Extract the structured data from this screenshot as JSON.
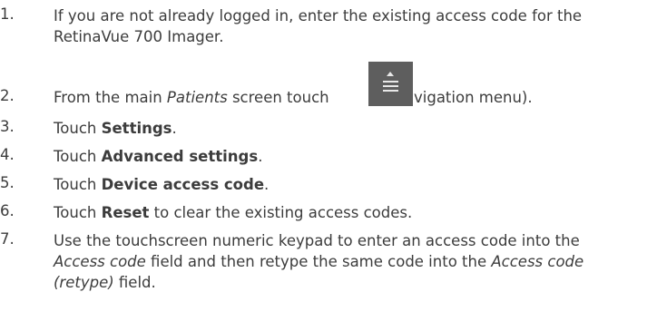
{
  "steps": [
    {
      "num": "1.",
      "line1": "If you are not already logged in, enter the existing access code for the",
      "line2": "RetinaVue 700 Imager."
    },
    {
      "num": "2.",
      "pre": "From the main ",
      "italic": "Patients",
      "mid": " screen touch ",
      "icon": "navigation-menu-icon",
      "post": " (Navigation menu)."
    },
    {
      "num": "3.",
      "pre": "Touch ",
      "bold": "Settings",
      "post": "."
    },
    {
      "num": "4.",
      "pre": "Touch ",
      "bold": "Advanced settings",
      "post": "."
    },
    {
      "num": "5.",
      "pre": "Touch ",
      "bold": "Device access code",
      "post": "."
    },
    {
      "num": "6.",
      "pre": "Touch ",
      "bold": "Reset",
      "post": " to clear the existing access codes."
    },
    {
      "num": "7.",
      "line1": "Use the touchscreen numeric keypad to enter an access code into the",
      "l2_italic": "Access code",
      "l2_mid": " field and then retype the same code into the ",
      "l2_italic2": "Access code",
      "l3_italic": "(retype)",
      "l3_post": " field."
    }
  ]
}
